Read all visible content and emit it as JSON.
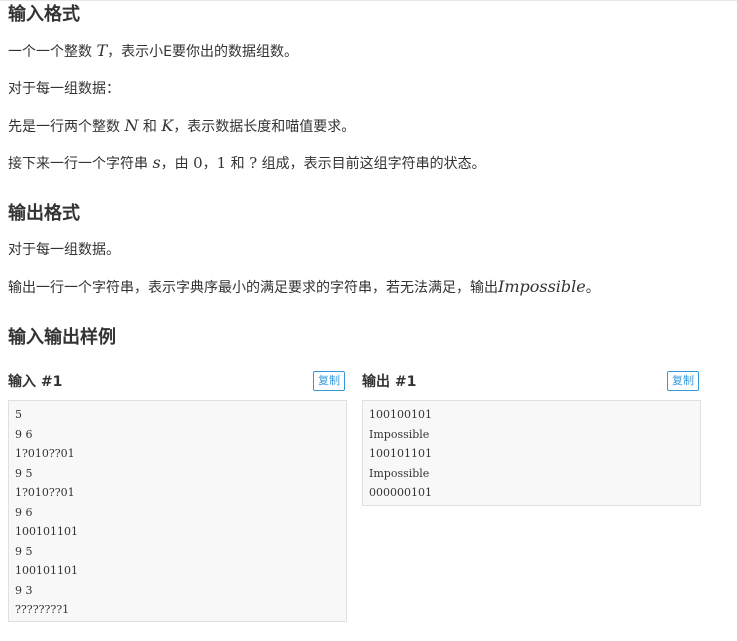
{
  "input_format": {
    "title": "输入格式",
    "line1": {
      "a": "一个一个整数 ",
      "m": "T",
      "b": "，表示小E要你出的数据组数。"
    },
    "line2": "对于每一组数据：",
    "line3": {
      "a": "先是一行两个整数 ",
      "m1": "N",
      "mid": " 和 ",
      "m2": "K",
      "b": "，表示数据长度和喵值要求。"
    },
    "line4": {
      "a": "接下来一行一个字符串 ",
      "m": "s",
      "b": "，由 ",
      "n0": "0",
      "sep1": "，",
      "n1": "1",
      "sep2": " 和 ",
      "q": "?",
      "c": " 组成，表示目前这组字符串的状态。"
    }
  },
  "output_format": {
    "title": "输出格式",
    "line1": "对于每一组数据。",
    "line2": {
      "a": "输出一行一个字符串，表示字典序最小的满足要求的字符串，若无法满足，输出",
      "m": "Impossible",
      "b": "。"
    }
  },
  "samples": {
    "title": "输入输出样例",
    "input": {
      "label": "输入 #1",
      "copy_label": "复制",
      "lines": [
        "5",
        "9 6",
        "1?010??01",
        "9 5",
        "1?010??01",
        "9 6",
        "100101101",
        "9 5",
        "100101101",
        "9 3",
        "????????1"
      ]
    },
    "output": {
      "label": "输出 #1",
      "copy_label": "复制",
      "lines": [
        "100100101",
        "Impossible",
        "100101101",
        "Impossible",
        "000000101"
      ]
    }
  },
  "colors": {
    "text": "#333333",
    "accent": "#3498db",
    "code_bg": "#f8f8f8",
    "border": "#e0e0e0"
  }
}
